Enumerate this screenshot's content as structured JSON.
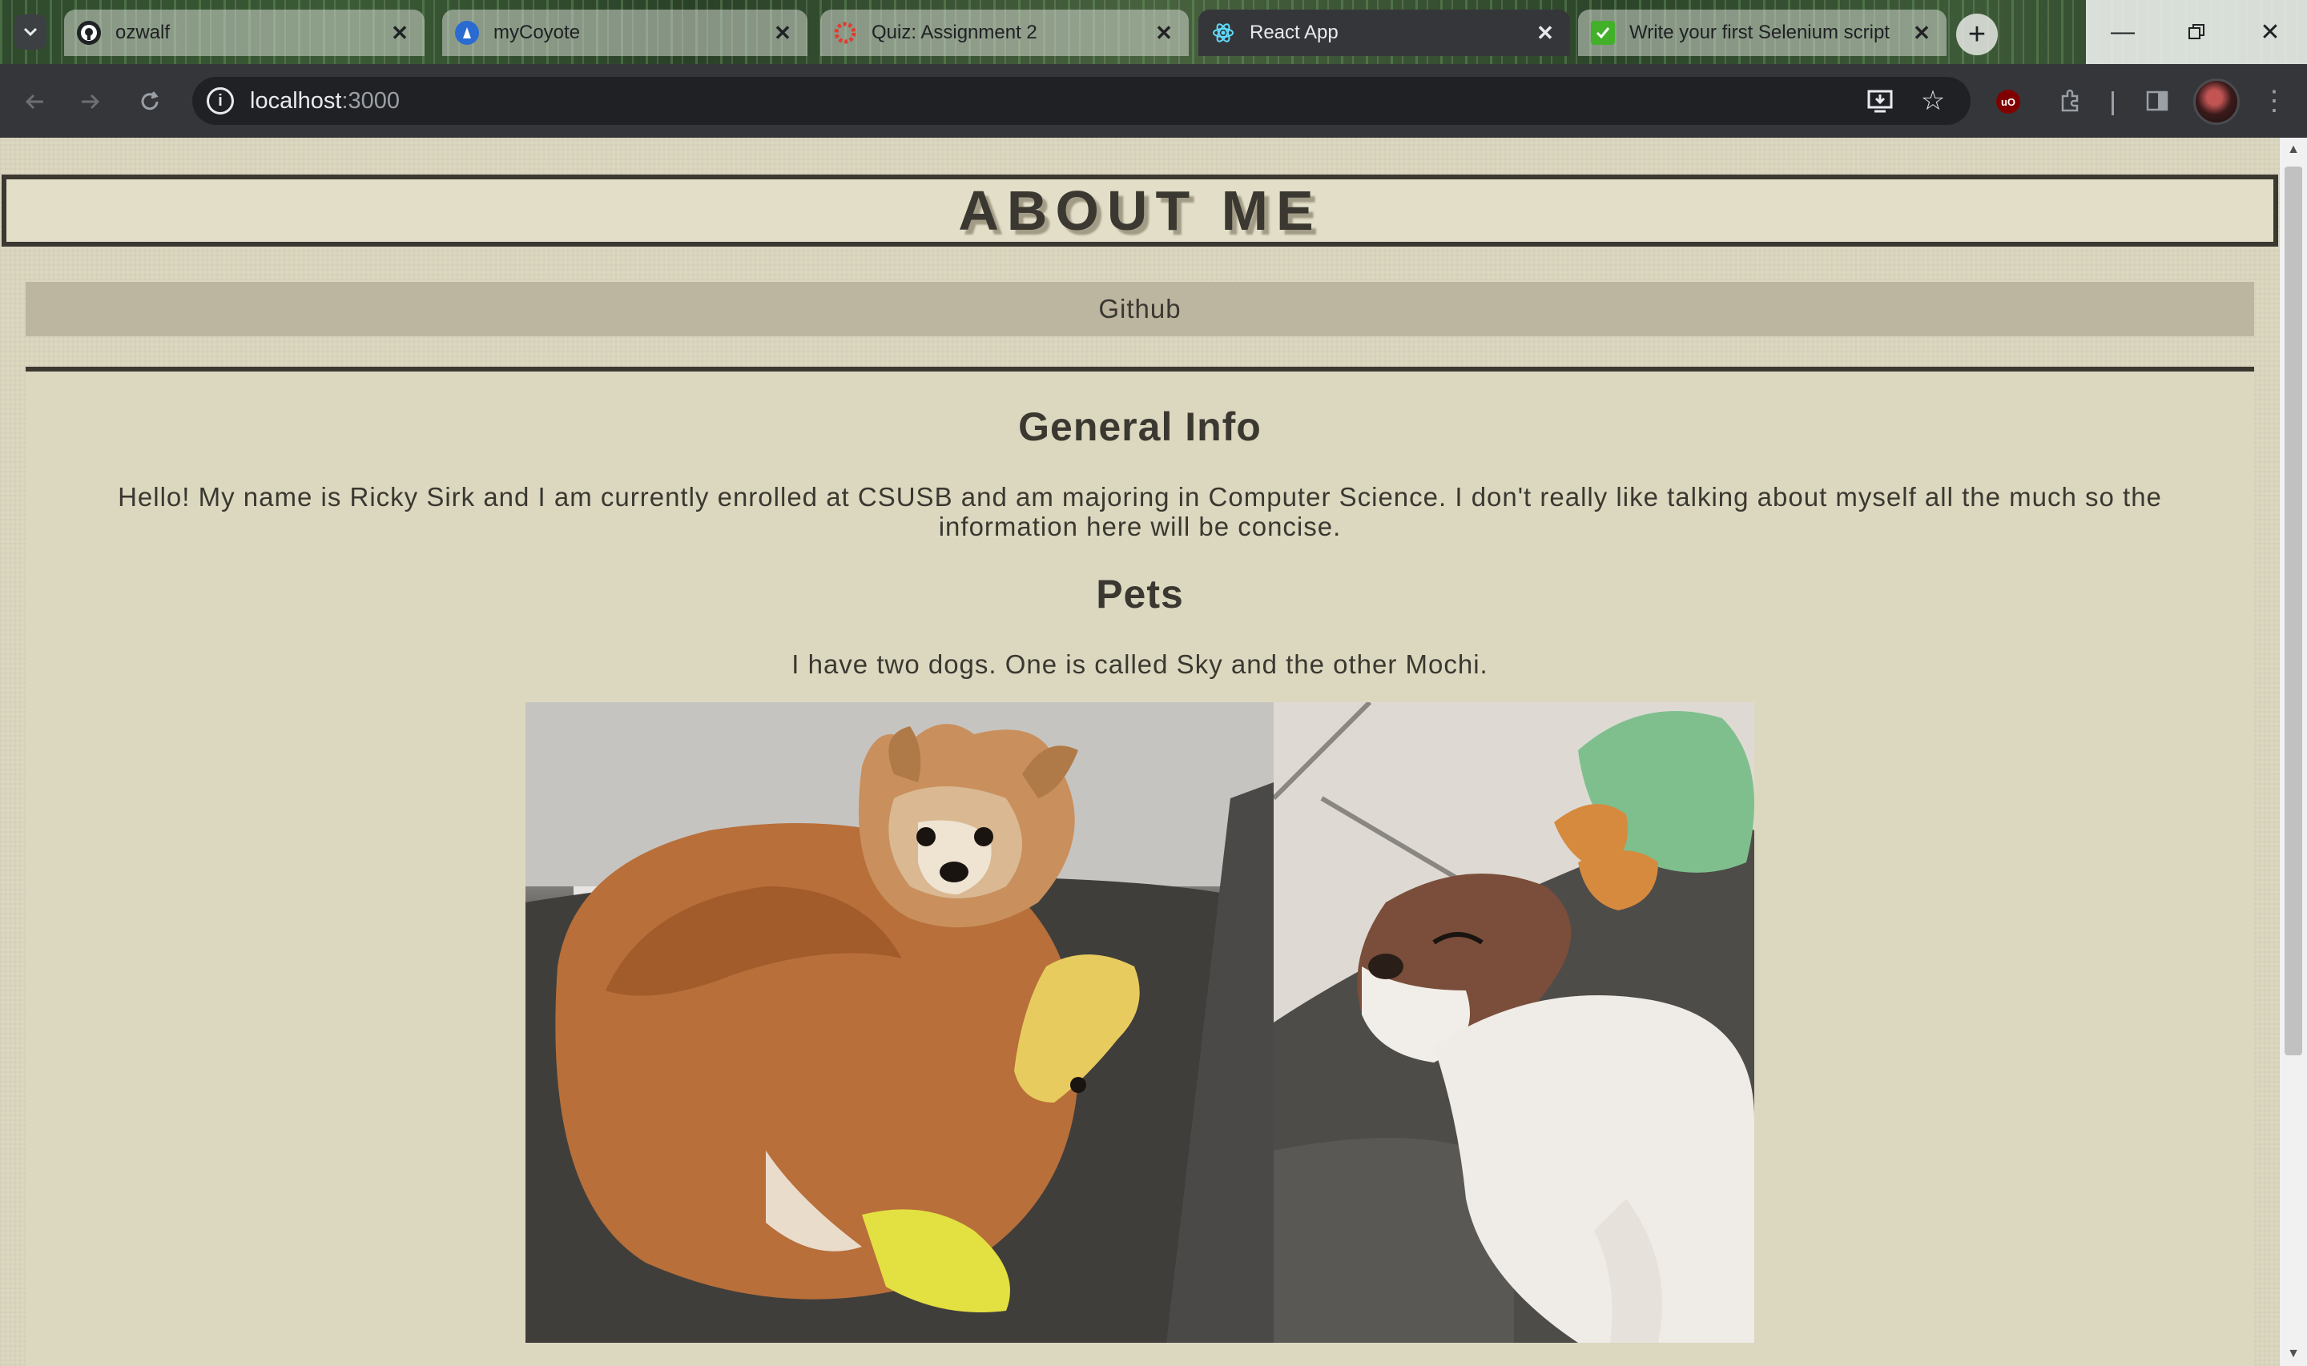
{
  "browser": {
    "tabs": [
      {
        "title": "ozwalf",
        "icon": "github-icon",
        "active": false
      },
      {
        "title": "myCoyote",
        "icon": "mycoyote-icon",
        "active": false
      },
      {
        "title": "Quiz: Assignment 2",
        "icon": "canvas-icon",
        "active": false
      },
      {
        "title": "React App",
        "icon": "react-icon",
        "active": true
      },
      {
        "title": "Write your first Selenium script",
        "icon": "selenium-icon",
        "active": false
      }
    ],
    "address": {
      "host": "localhost",
      "port": ":3000"
    }
  },
  "page": {
    "heading": "ABOUT ME",
    "nav_link": "Github",
    "sections": {
      "general_title": "General Info",
      "general_text": "Hello! My name is Ricky Sirk and I am currently enrolled at CSUSB and am majoring in Computer Science. I don't really like talking about myself all the much so the information here will be concise.",
      "pets_title": "Pets",
      "pets_text": "I have two dogs. One is called Sky and the other Mochi."
    }
  },
  "colors": {
    "page_background": "#dcd8c0",
    "nav_background": "#bcb5a0",
    "text": "#3a3830"
  }
}
